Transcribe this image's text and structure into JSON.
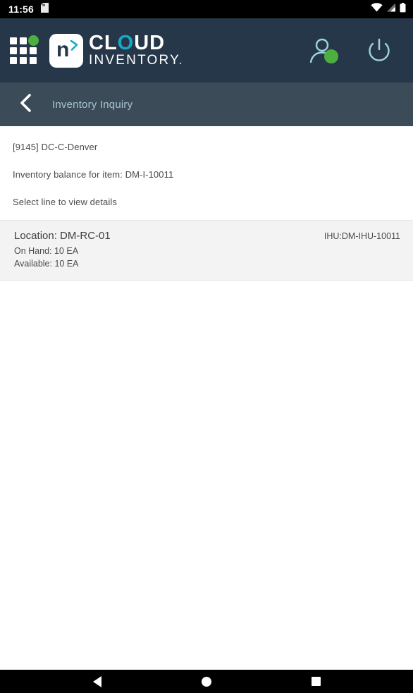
{
  "status_bar": {
    "clock": "11:56",
    "left_icon": "sim-card-icon",
    "right_icons": [
      "wifi-icon",
      "cellular-signal-icon",
      "battery-icon"
    ]
  },
  "header": {
    "grid_menu_icon": "apps-grid-icon",
    "logo": {
      "badge_letter": "n",
      "badge_chevron_icon": "chevron-right-icon",
      "line1_before": "CL",
      "line1_accent": "O",
      "line1_after": "UD",
      "line2": "INVENTORY",
      "line2_period": ".",
      "accent_color": "#17a9c8"
    },
    "user_icon": "user-account-icon",
    "user_status": "online",
    "power_icon": "power-icon",
    "background_color": "#26374a"
  },
  "sub_header": {
    "back_icon": "back-chevron-icon",
    "title": "Inventory Inquiry",
    "background_color": "#3c4b58",
    "title_color": "#a8c4d4"
  },
  "content": {
    "site_line": "[9145] DC-C-Denver",
    "balance_line": "Inventory balance for item: DM-I-10011",
    "instruction_line": "Select line to view details",
    "results": [
      {
        "location": "Location: DM-RC-01",
        "on_hand": "On Hand: 10 EA",
        "available": "Available: 10 EA",
        "ihu": "IHU:DM-IHU-10011"
      }
    ]
  },
  "nav_bar": {
    "back_icon": "android-back-icon",
    "home_icon": "android-home-icon",
    "recents_icon": "android-recents-icon"
  }
}
